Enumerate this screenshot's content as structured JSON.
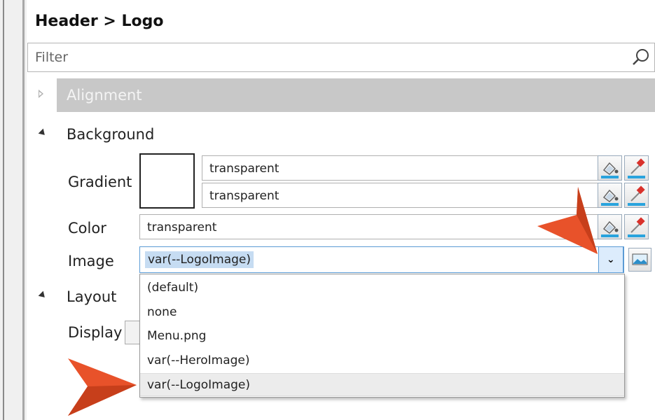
{
  "panel": {
    "breadcrumb": "Header > Logo",
    "filter_placeholder": "Filter"
  },
  "sections": {
    "alignment": "Alignment",
    "background": "Background",
    "layout": "Layout"
  },
  "background": {
    "gradient_label": "Gradient",
    "gradient_color_1": "transparent",
    "gradient_color_2": "transparent",
    "color_label": "Color",
    "color_value": "transparent",
    "image_label": "Image",
    "image_value": "var(--LogoImage)"
  },
  "layout": {
    "display_label": "Display"
  },
  "image_dropdown": {
    "options": [
      "(default)",
      "none",
      "Menu.png",
      "var(--HeroImage)",
      "var(--LogoImage)"
    ],
    "highlighted": "var(--LogoImage)"
  },
  "colors": {
    "accent": "#5b9bd5",
    "callout_arrow": "#e8522a",
    "section_bar": "#c8c8c8"
  },
  "icons": {
    "filter": "search-icon",
    "picker": "paint-bucket-icon",
    "eyedropper": "eyedropper-icon",
    "image_browse": "image-icon",
    "dropdown": "chevron-down-icon"
  }
}
